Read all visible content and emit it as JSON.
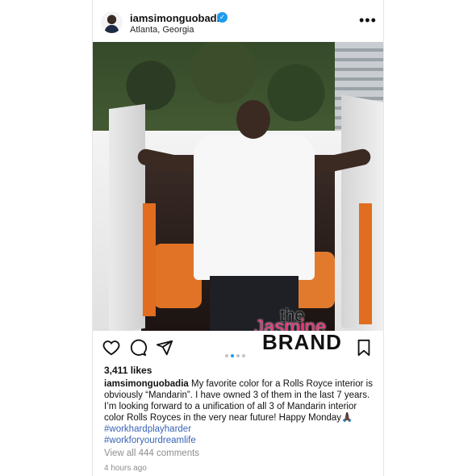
{
  "post": {
    "username": "iamsimonguobadia",
    "location": "Atlanta, Georgia",
    "more_icon": "ellipsis-icon",
    "verified_icon": "verified-badge-icon",
    "image": {
      "watermark_the": "the",
      "watermark_jasmine": "Jasmine",
      "watermark_brand": "BRAND"
    },
    "likes": "3,411 likes",
    "caption_user": "iamsimonguobadia",
    "caption_text": "My favorite color for a Rolls Royce interior is obviously “Mandarin”. I have owned 3 of them in the last 7 years. I’m looking forward to a unification of all 3 of Mandarin interior color Rolls Royces in the very near future! Happy Monday🙏🏿",
    "hashtag1": "#workhardplayharder",
    "hashtag2": "#workforyourdreamlife",
    "view_comments": "View all 444 comments",
    "time_ago": "4 hours ago",
    "carousel": {
      "count": 4,
      "active_index": 1
    }
  },
  "colors": {
    "verified": "#1d9bf0",
    "hashtag": "#3a63b5",
    "watermark_pink": "#e6357b",
    "seat_mandarin": "#e07326"
  }
}
